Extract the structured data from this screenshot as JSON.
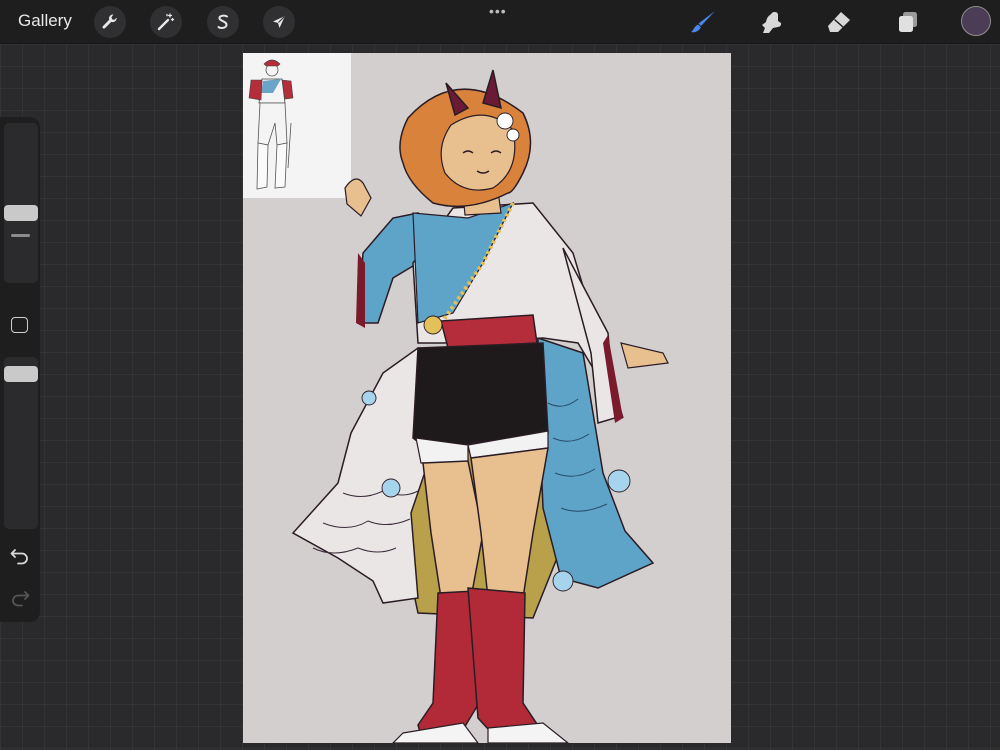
{
  "app": {
    "gallery_label": "Gallery",
    "more_menu_label": "•••"
  },
  "toolbar_left": [
    {
      "name": "actions",
      "icon": "wrench-icon"
    },
    {
      "name": "adjustments",
      "icon": "magic-wand-icon"
    },
    {
      "name": "selection",
      "icon": "selection-s-icon"
    },
    {
      "name": "transform",
      "icon": "arrow-cursor-icon"
    }
  ],
  "toolbar_right": [
    {
      "name": "brush",
      "icon": "brush-icon",
      "active": true
    },
    {
      "name": "smudge",
      "icon": "smudge-icon",
      "active": false
    },
    {
      "name": "eraser",
      "icon": "eraser-icon",
      "active": false
    },
    {
      "name": "layers",
      "icon": "layers-icon",
      "active": false
    }
  ],
  "colors": {
    "current_color": "#4a3d55",
    "active_tool": "#4a86f0",
    "canvas_background": "#d3cfcf"
  },
  "sidebar": {
    "brush_size_level": 0.45,
    "opacity_level": 0.9,
    "undo_icon": "undo-icon",
    "redo_icon": "redo-icon",
    "modify_icon": "square-icon"
  }
}
